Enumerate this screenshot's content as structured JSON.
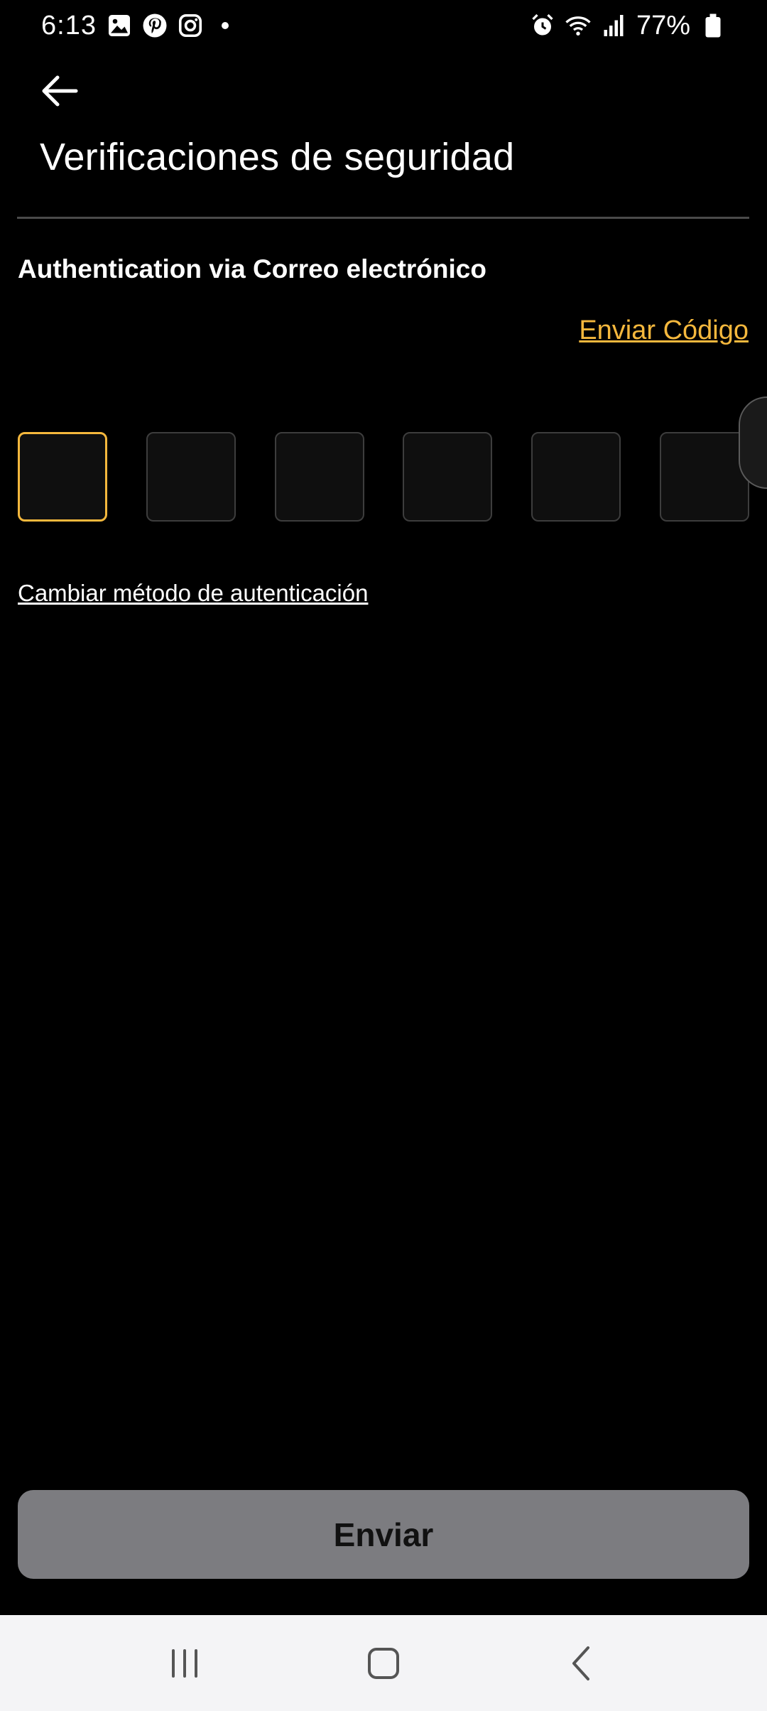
{
  "status_bar": {
    "time": "6:13",
    "battery_percent": "77%",
    "left_icons": [
      "gallery-icon",
      "pinterest-icon",
      "instagram-icon",
      "notification-dot"
    ],
    "right_icons": [
      "alarm-icon",
      "wifi-icon",
      "signal-icon",
      "battery-icon"
    ]
  },
  "header": {
    "title": "Verificaciones de seguridad",
    "back_icon": "back-arrow-icon"
  },
  "auth": {
    "heading": "Authentication via Correo electrónico",
    "send_code_label": "Enviar Código",
    "code_length": 6,
    "active_box_index": 0,
    "change_method_label": "Cambiar método de autenticación"
  },
  "actions": {
    "submit_label": "Enviar"
  },
  "nav_bar": {
    "buttons": [
      "recent-apps-icon",
      "home-icon",
      "back-icon"
    ]
  },
  "colors": {
    "background": "#000000",
    "accent": "#f5b83d",
    "submit_disabled": "#7c7c80",
    "nav_bar": "#f4f4f6"
  }
}
